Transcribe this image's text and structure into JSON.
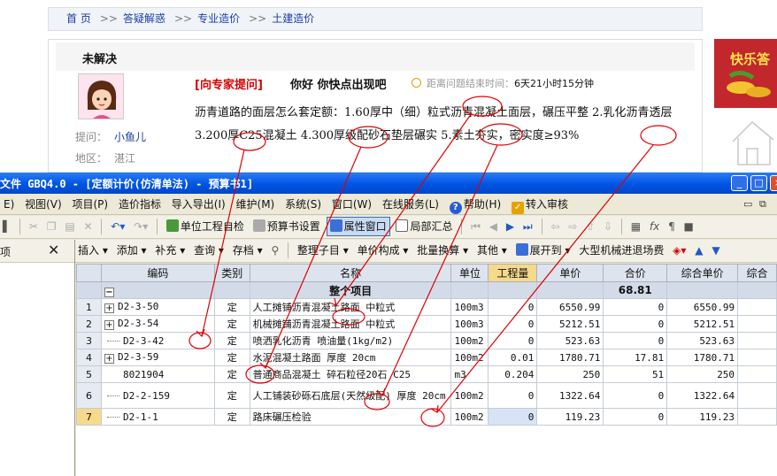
{
  "web": {
    "breadcrumb": [
      "首 页",
      "答疑解惑",
      "专业造价",
      "土建造价"
    ],
    "breadcrumb_sep": ">>",
    "status_title": "未解决",
    "asker_label": "提问：",
    "asker_name": "小鱼儿",
    "region_label": "地区：",
    "region_value": "湛江",
    "ask_link": "[向专家提问]",
    "question_title": "你好 你快点出现吧",
    "timer_label": "距离问题结束时间：",
    "timer_value": "6天21小时15分钟",
    "question_body": "沥青道路的面层怎么套定额：1.60厚中（细）粒式沥青混凝土面层，碾压平整 2.乳化沥青透层 3.200厚C25混凝土 4.300厚级配砂石垫层碾实 5.素土夯实，密实度≥93%",
    "ad_text": "快乐答"
  },
  "app": {
    "window_title": "文件 GBQ4.0 - [定额计价(仿清单法) - 预算书1]",
    "window_buttons": [
      "_",
      "□",
      "×"
    ],
    "menu": [
      {
        "label": "E)"
      },
      {
        "label": "视图(V)"
      },
      {
        "label": "项目(P)"
      },
      {
        "label": "造价指标"
      },
      {
        "label": "导入导出(I)"
      },
      {
        "label": "维护(M)"
      },
      {
        "label": "系统(S)"
      },
      {
        "label": "窗口(W)"
      },
      {
        "label": "在线服务(L)"
      },
      {
        "label": "帮助(H)"
      },
      {
        "label": "转入审核"
      }
    ],
    "toolbar1": {
      "unit_project": "单位工程自检",
      "budget_settings": "预算书设置",
      "property_window": "属性窗口",
      "partial_summary": "局部汇总"
    },
    "toolbar2": [
      "插入",
      "添加",
      "补充",
      "查询",
      "存档",
      "整理子目",
      "单价构成",
      "批量换算",
      "其他",
      "展开到",
      "大型机械进退场费"
    ],
    "left_pane_title": "项",
    "grid": {
      "columns": [
        "编码",
        "类别",
        "名称",
        "单位",
        "工程量",
        "单价",
        "合价",
        "综合单价",
        "综合"
      ],
      "total_row": {
        "label": "整个项目",
        "amount": "68.81"
      },
      "rows": [
        {
          "no": "1",
          "code": "D2-3-50",
          "type": "定",
          "name": "人工摊铺沥青混凝土路面 中粒式",
          "unit": "100m3",
          "qty": "0",
          "price": "6550.99",
          "amount": "0",
          "unit_total": "6550.99",
          "expandable": true
        },
        {
          "no": "2",
          "code": "D2-3-54",
          "type": "定",
          "name": "机械摊铺沥青混凝土路面 中粒式",
          "unit": "100m3",
          "qty": "0",
          "price": "5212.51",
          "amount": "0",
          "unit_total": "5212.51",
          "expandable": true
        },
        {
          "no": "3",
          "code": "D2-3-42",
          "type": "定",
          "name": "喷洒乳化沥青 喷油量(1kg/m2)",
          "unit": "100m2",
          "qty": "0",
          "price": "523.63",
          "amount": "0",
          "unit_total": "523.63",
          "expandable": false
        },
        {
          "no": "4",
          "code": "D2-3-59",
          "type": "定",
          "name": "水泥混凝土路面 厚度 20cm",
          "unit": "100m2",
          "qty": "0.01",
          "price": "1780.71",
          "amount": "17.81",
          "unit_total": "1780.71",
          "expandable": true
        },
        {
          "no": "5",
          "code": "8021904",
          "type": "定",
          "name": "普通商品混凝土 碎石粒径20石 C25",
          "unit": "m3",
          "qty": "0.204",
          "price": "250",
          "amount": "51",
          "unit_total": "250",
          "expandable": false
        },
        {
          "no": "6",
          "code": "D2-2-159",
          "type": "定",
          "name": "人工铺装砂砾石底层(天然级配) 厚度 20cm",
          "unit": "100m2",
          "qty": "0",
          "price": "1322.64",
          "amount": "0",
          "unit_total": "1322.64",
          "expandable": false
        },
        {
          "no": "7",
          "code": "D2-1-1",
          "type": "定",
          "name": "路床碾压检验",
          "unit": "100m2",
          "qty": "0",
          "price": "119.23",
          "amount": "0",
          "unit_total": "119.23",
          "expandable": false
        }
      ]
    }
  },
  "colors": {
    "annotation": "#e00000",
    "title_bar": "#0054e3",
    "link": "#1a3ea0",
    "selected_header": "#f6d98a"
  }
}
